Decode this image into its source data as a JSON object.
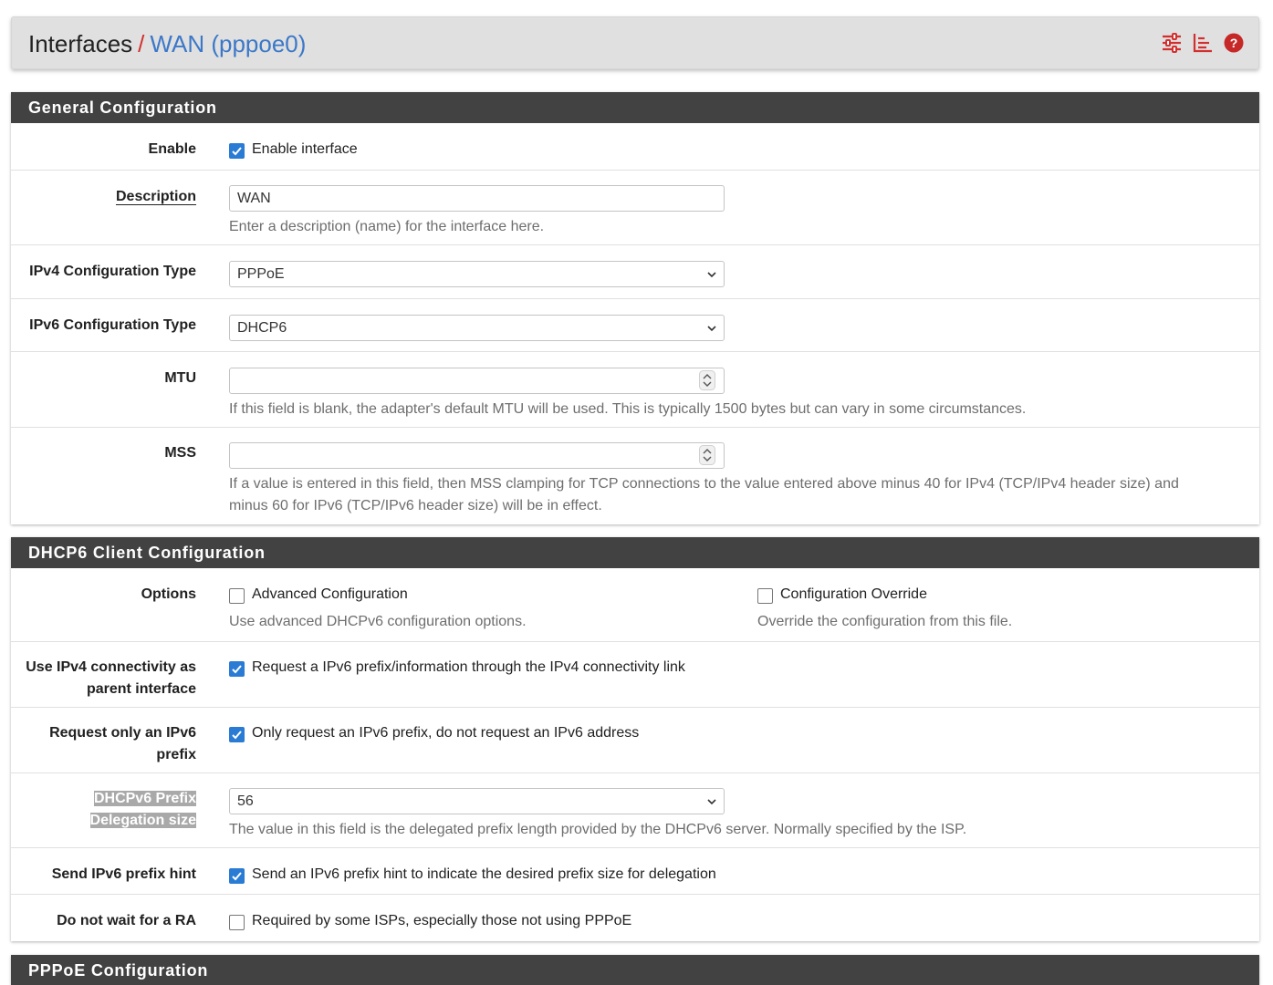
{
  "breadcrumb": {
    "parent": "Interfaces",
    "separator": "/",
    "current": "WAN (pppoe0)"
  },
  "header_icons": [
    "settings-sliders-icon",
    "chart-icon",
    "help-icon"
  ],
  "colors": {
    "accent_red": "#d32f2f",
    "link_blue": "#3c78c8",
    "panel_heading_bg": "#424242",
    "checkbox_blue": "#2a7bd4"
  },
  "general": {
    "heading": "General Configuration",
    "enable": {
      "label": "Enable",
      "checkbox_label": "Enable interface",
      "checked": true
    },
    "description": {
      "label": "Description",
      "value": "WAN",
      "help": "Enter a description (name) for the interface here."
    },
    "ipv4_type": {
      "label": "IPv4 Configuration Type",
      "value": "PPPoE"
    },
    "ipv6_type": {
      "label": "IPv6 Configuration Type",
      "value": "DHCP6"
    },
    "mtu": {
      "label": "MTU",
      "value": "",
      "help": "If this field is blank, the adapter's default MTU will be used. This is typically 1500 bytes but can vary in some circumstances."
    },
    "mss": {
      "label": "MSS",
      "value": "",
      "help1": "If a value is entered in this field, then MSS clamping for TCP connections to the value entered above minus 40 for IPv4 (TCP/IPv4 header size) and",
      "help2": "minus 60 for IPv6 (TCP/IPv6 header size) will be in effect."
    }
  },
  "dhcp6": {
    "heading": "DHCP6 Client Configuration",
    "options": {
      "label": "Options",
      "advanced": {
        "checkbox_label": "Advanced Configuration",
        "help": "Use advanced DHCPv6 configuration options.",
        "checked": false
      },
      "override": {
        "checkbox_label": "Configuration Override",
        "help": "Override the configuration from this file.",
        "checked": false
      }
    },
    "ipv4_parent": {
      "label1": "Use IPv4 connectivity as",
      "label2": "parent interface",
      "checkbox_label": "Request a IPv6 prefix/information through the IPv4 connectivity link",
      "checked": true
    },
    "prefix_only": {
      "label1": "Request only an IPv6",
      "label2": "prefix",
      "checkbox_label": "Only request an IPv6 prefix, do not request an IPv6 address",
      "checked": true
    },
    "delegation_size": {
      "label1": "DHCPv6 Prefix",
      "label2": "Delegation size",
      "value": "56",
      "help": "The value in this field is the delegated prefix length provided by the DHCPv6 server. Normally specified by the ISP."
    },
    "prefix_hint": {
      "label": "Send IPv6 prefix hint",
      "checkbox_label": "Send an IPv6 prefix hint to indicate the desired prefix size for delegation",
      "checked": true
    },
    "no_wait_ra": {
      "label": "Do not wait for a RA",
      "checkbox_label": "Required by some ISPs, especially those not using PPPoE",
      "checked": false
    }
  },
  "pppoe": {
    "heading": "PPPoE Configuration"
  }
}
